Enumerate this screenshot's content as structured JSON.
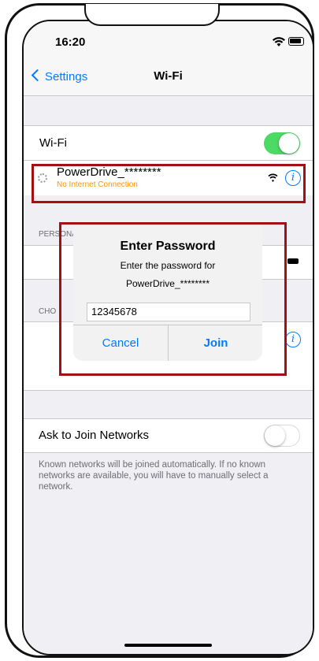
{
  "status_bar": {
    "time": "16:20"
  },
  "nav": {
    "back_label": "Settings",
    "title": "Wi-Fi"
  },
  "wifi_row": {
    "label": "Wi-Fi",
    "enabled": true
  },
  "current_network": {
    "name": "PowerDrive_********",
    "status": "No Internet Connection"
  },
  "personal_hotspots": {
    "header": "PERSONAL HOTSPOTS"
  },
  "choose_network": {
    "header_partial": "CHO"
  },
  "alert": {
    "title": "Enter Password",
    "message_line1": "Enter the password for",
    "message_line2": "PowerDrive_********",
    "password_value": "12345678",
    "cancel_label": "Cancel",
    "join_label": "Join"
  },
  "ask_to_join": {
    "label": "Ask to Join Networks",
    "enabled": false
  },
  "footer": {
    "text": "Known networks will be joined automatically. If no known networks are available, you will have to manually select a network."
  },
  "colors": {
    "accent": "#007aff",
    "switch_on": "#4cd964",
    "warning": "#ff9500",
    "highlight": "#a50f14"
  },
  "icons": [
    "chevron-left-icon",
    "wifi-icon",
    "battery-icon",
    "spinner-icon",
    "lock-icon",
    "info-icon"
  ]
}
